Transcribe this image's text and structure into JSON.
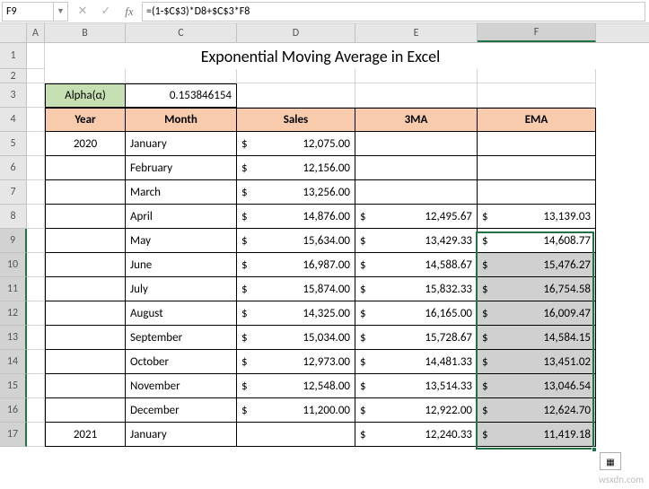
{
  "namebox": "F9",
  "formula": "=(1-$C$3)*D8+$C$3*F8",
  "columns": [
    "A",
    "B",
    "C",
    "D",
    "E",
    "F"
  ],
  "title": "Exponential Moving Average in Excel",
  "alpha": {
    "label": "Alpha(α)",
    "value": "0.153846154"
  },
  "headers": {
    "year": "Year",
    "month": "Month",
    "sales": "Sales",
    "ma3": "3MA",
    "ema": "EMA"
  },
  "rows": [
    {
      "r": 5,
      "year": "2020",
      "month": "January",
      "sales": "12,075.00",
      "ma3": "",
      "ema": ""
    },
    {
      "r": 6,
      "year": "",
      "month": "February",
      "sales": "12,156.00",
      "ma3": "",
      "ema": ""
    },
    {
      "r": 7,
      "year": "",
      "month": "March",
      "sales": "13,256.00",
      "ma3": "",
      "ema": ""
    },
    {
      "r": 8,
      "year": "",
      "month": "April",
      "sales": "14,876.00",
      "ma3": "12,495.67",
      "ema": "13,139.03"
    },
    {
      "r": 9,
      "year": "",
      "month": "May",
      "sales": "15,634.00",
      "ma3": "13,429.33",
      "ema": "14,608.77"
    },
    {
      "r": 10,
      "year": "",
      "month": "June",
      "sales": "16,987.00",
      "ma3": "14,588.67",
      "ema": "15,476.27"
    },
    {
      "r": 11,
      "year": "",
      "month": "July",
      "sales": "15,874.00",
      "ma3": "15,832.33",
      "ema": "16,754.58"
    },
    {
      "r": 12,
      "year": "",
      "month": "August",
      "sales": "14,325.00",
      "ma3": "16,165.00",
      "ema": "16,009.47"
    },
    {
      "r": 13,
      "year": "",
      "month": "September",
      "sales": "15,034.00",
      "ma3": "15,728.67",
      "ema": "14,584.15"
    },
    {
      "r": 14,
      "year": "",
      "month": "October",
      "sales": "12,973.00",
      "ma3": "14,481.33",
      "ema": "13,451.02"
    },
    {
      "r": 15,
      "year": "",
      "month": "November",
      "sales": "12,548.00",
      "ma3": "13,514.33",
      "ema": "13,046.54"
    },
    {
      "r": 16,
      "year": "",
      "month": "December",
      "sales": "11,200.00",
      "ma3": "12,922.00",
      "ema": "12,624.70"
    },
    {
      "r": 17,
      "year": "2021",
      "month": "January",
      "sales": "",
      "ma3": "12,240.33",
      "ema": "11,419.18"
    }
  ],
  "watermark": "wsxdn.com"
}
